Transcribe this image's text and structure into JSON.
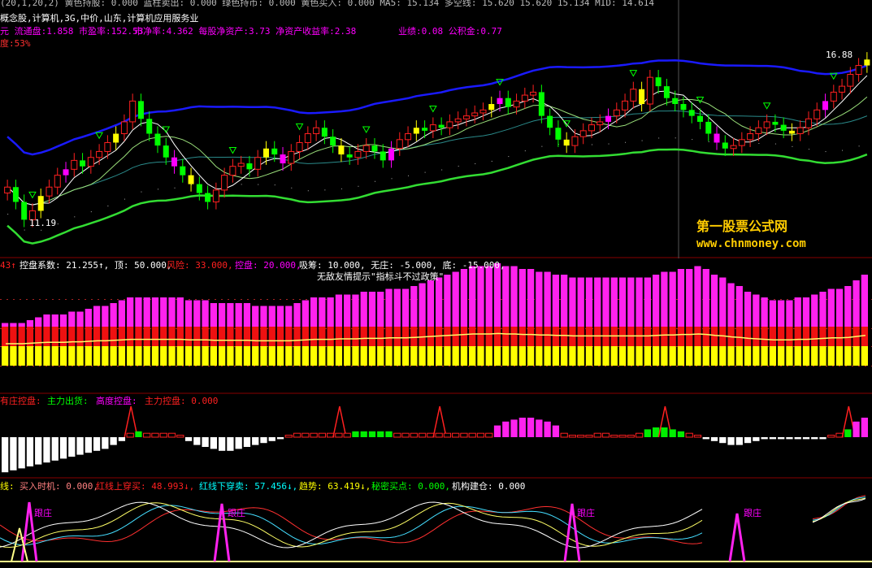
{
  "top_bar": {
    "line1": "(20,1,20,2)  黄色持股: 0.000  蓝柱卖出: 0.000  绿色持币: 0.000  黄色买入: 0.000  MA5: 15.134  多空线: 15.620  15.620  15.134  MID: 14.614",
    "line2": "概念股,计算机,3G,中价,山东,计算机应用服务业",
    "line3_a": "元  流通盘:1.858  市盈率:152.53",
    "line3_b": "市净率:4.362  每股净资产:3.73  净资产收益率:2.38",
    "line3_c": "业绩:0.08  公积金:0.77",
    "line4": "度:53%"
  },
  "price_labels": {
    "high": "16.88",
    "low": "11.19"
  },
  "brand": {
    "name": "第一股票公式网",
    "url": "www.chnmoney.com"
  },
  "pane2": {
    "header_a": "43↑",
    "header_b": "控盘系数: 21.255↑, 顶: 50.000,",
    "header_risk": "风险: 33.000,",
    "header_ctrl": "控盘: 20.000,",
    "header_c": "吸筹: 10.000, 无庄: -5.000, 底: -15.000,",
    "subtitle": "无敌友情提示\"指标斗不过政策\""
  },
  "pane3": {
    "header_a": "有庄控盘: ",
    "header_b": "主力出货: ",
    "header_c": "高度控盘: ",
    "header_d": "主力控盘: 0.000"
  },
  "pane4": {
    "h0": "线:",
    "h1": "买入时机: 0.000,",
    "h2": "红线上穿买: 48.993↓,",
    "h3": "红线下穿卖: 57.456↓,",
    "h4": "趋势: 63.419↓,",
    "h5": "秘密买点: 0.000,",
    "h6": "机构建仓: 0.000",
    "tag": "跟庄"
  },
  "colors": {
    "up": "#ff2020",
    "down": "#00ff00",
    "yellow": "#ffff00",
    "magenta": "#ff00ff",
    "blue": "#1a1aff",
    "white": "#ffffff",
    "grid": "#880000"
  },
  "chart_data": [
    {
      "type": "candlestick",
      "title": "",
      "price_range": [
        11.19,
        16.88
      ],
      "annotations": [
        "16.88",
        "11.19"
      ],
      "closes": [
        12.4,
        11.9,
        11.3,
        11.6,
        12.1,
        12.4,
        12.8,
        13.0,
        13.3,
        13.1,
        13.4,
        13.6,
        13.9,
        14.2,
        14.6,
        15.3,
        14.7,
        14.2,
        13.8,
        13.4,
        13.1,
        12.8,
        12.5,
        12.2,
        11.9,
        12.3,
        12.8,
        13.1,
        13.2,
        13.0,
        13.4,
        13.7,
        13.5,
        13.2,
        13.6,
        13.9,
        14.2,
        14.4,
        14.1,
        13.8,
        13.5,
        13.4,
        13.6,
        13.8,
        13.6,
        13.3,
        13.7,
        14.0,
        14.2,
        14.4,
        14.3,
        14.5,
        14.4,
        14.6,
        14.7,
        14.8,
        14.9,
        15.0,
        15.2,
        15.4,
        15.1,
        15.3,
        15.5,
        15.6,
        14.8,
        14.4,
        14.0,
        13.8,
        14.1,
        14.3,
        14.5,
        14.6,
        14.8,
        15.0,
        15.3,
        15.7,
        15.2,
        16.1,
        15.8,
        15.4,
        15.2,
        15.0,
        14.8,
        14.6,
        14.2,
        13.9,
        13.7,
        13.8,
        14.0,
        14.2,
        14.4,
        14.6,
        14.5,
        14.3,
        14.2,
        14.4,
        14.7,
        15.0,
        15.3,
        15.6,
        15.8,
        16.2,
        16.5,
        16.7
      ]
    },
    {
      "type": "bar",
      "title": "",
      "values": [
        0.15,
        0.15,
        0.15,
        0.16,
        0.17,
        0.18,
        0.18,
        0.18,
        0.19,
        0.19,
        0.2,
        0.21,
        0.21,
        0.22,
        0.23,
        0.24,
        0.24,
        0.24,
        0.24,
        0.24,
        0.24,
        0.24,
        0.23,
        0.23,
        0.23,
        0.22,
        0.22,
        0.22,
        0.22,
        0.22,
        0.21,
        0.21,
        0.21,
        0.21,
        0.21,
        0.22,
        0.23,
        0.24,
        0.24,
        0.24,
        0.25,
        0.25,
        0.25,
        0.26,
        0.26,
        0.26,
        0.27,
        0.27,
        0.27,
        0.28,
        0.29,
        0.3,
        0.31,
        0.32,
        0.33,
        0.34,
        0.35,
        0.35,
        0.35,
        0.36,
        0.35,
        0.35,
        0.34,
        0.34,
        0.33,
        0.33,
        0.32,
        0.32,
        0.31,
        0.31,
        0.31,
        0.31,
        0.31,
        0.31,
        0.31,
        0.31,
        0.31,
        0.31,
        0.32,
        0.33,
        0.33,
        0.34,
        0.34,
        0.35,
        0.34,
        0.32,
        0.31,
        0.29,
        0.28,
        0.26,
        0.25,
        0.24,
        0.23,
        0.23,
        0.23,
        0.24,
        0.24,
        0.25,
        0.26,
        0.27,
        0.27,
        0.28,
        0.3,
        0.32
      ]
    },
    {
      "type": "bar",
      "title": "",
      "values": [
        -0.9,
        -0.85,
        -0.8,
        -0.75,
        -0.7,
        -0.65,
        -0.6,
        -0.55,
        -0.5,
        -0.45,
        -0.4,
        -0.35,
        -0.3,
        -0.2,
        -0.1,
        0.1,
        0.15,
        0.1,
        0.1,
        0.1,
        0.1,
        0.05,
        -0.1,
        -0.2,
        -0.25,
        -0.3,
        -0.35,
        -0.35,
        -0.3,
        -0.25,
        -0.2,
        -0.15,
        -0.1,
        -0.05,
        0.05,
        0.1,
        0.1,
        0.1,
        0.1,
        0.1,
        0.1,
        0.1,
        0.15,
        0.15,
        0.15,
        0.15,
        0.15,
        0.1,
        0.1,
        0.1,
        0.1,
        0.1,
        0.1,
        0.1,
        0.1,
        0.1,
        0.1,
        0.1,
        0.1,
        0.3,
        0.4,
        0.45,
        0.5,
        0.5,
        0.45,
        0.4,
        0.3,
        0.1,
        0.05,
        0.05,
        0.05,
        0.1,
        0.1,
        0.05,
        0.05,
        0.05,
        0.1,
        0.2,
        0.25,
        0.25,
        0.2,
        0.15,
        0.1,
        0.05,
        -0.05,
        -0.1,
        -0.15,
        -0.2,
        -0.2,
        -0.15,
        -0.1,
        -0.05,
        -0.05,
        -0.05,
        -0.05,
        -0.05,
        -0.05,
        -0.05,
        -0.05,
        0.05,
        0.1,
        0.2,
        0.4,
        0.5
      ]
    }
  ]
}
